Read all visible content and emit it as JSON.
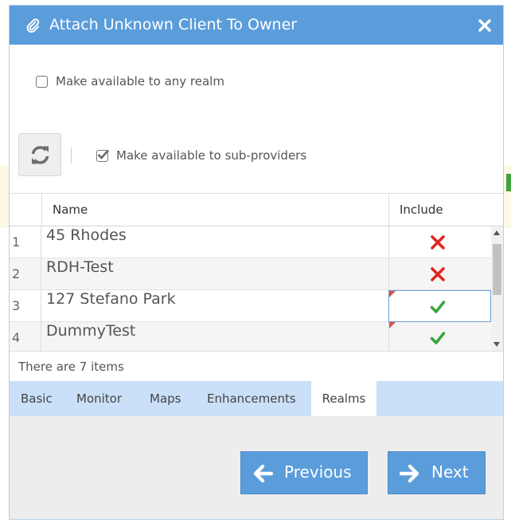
{
  "dialog": {
    "title": "Attach Unknown Client To Owner",
    "title_icon": "paperclip-icon",
    "close_icon": "close-icon"
  },
  "options": {
    "any_realm_label": "Make available to any realm",
    "any_realm_checked": false,
    "sub_providers_label": "Make available to sub-providers",
    "sub_providers_checked": true,
    "refresh_icon": "refresh-icon"
  },
  "grid": {
    "columns": [
      "Name",
      "Include"
    ],
    "rows": [
      {
        "num": "1",
        "name": "45 Rhodes",
        "include": false
      },
      {
        "num": "2",
        "name": "RDH-Test",
        "include": false
      },
      {
        "num": "3",
        "name": "127 Stefano Park",
        "include": true
      },
      {
        "num": "4",
        "name": "DummyTest",
        "include": true
      }
    ],
    "footer": "There are 7 items"
  },
  "tabs": [
    {
      "label": "Basic",
      "active": false
    },
    {
      "label": "Monitor",
      "active": false
    },
    {
      "label": "Maps",
      "active": false
    },
    {
      "label": "Enhancements",
      "active": false
    },
    {
      "label": "Realms",
      "active": true
    }
  ],
  "buttons": {
    "previous_label": "Previous",
    "next_label": "Next"
  },
  "colors": {
    "accent": "#5b9ddb",
    "tab_bar": "#c9e0f8",
    "check_green": "#3aa53a",
    "cross_red": "#e0261f"
  }
}
